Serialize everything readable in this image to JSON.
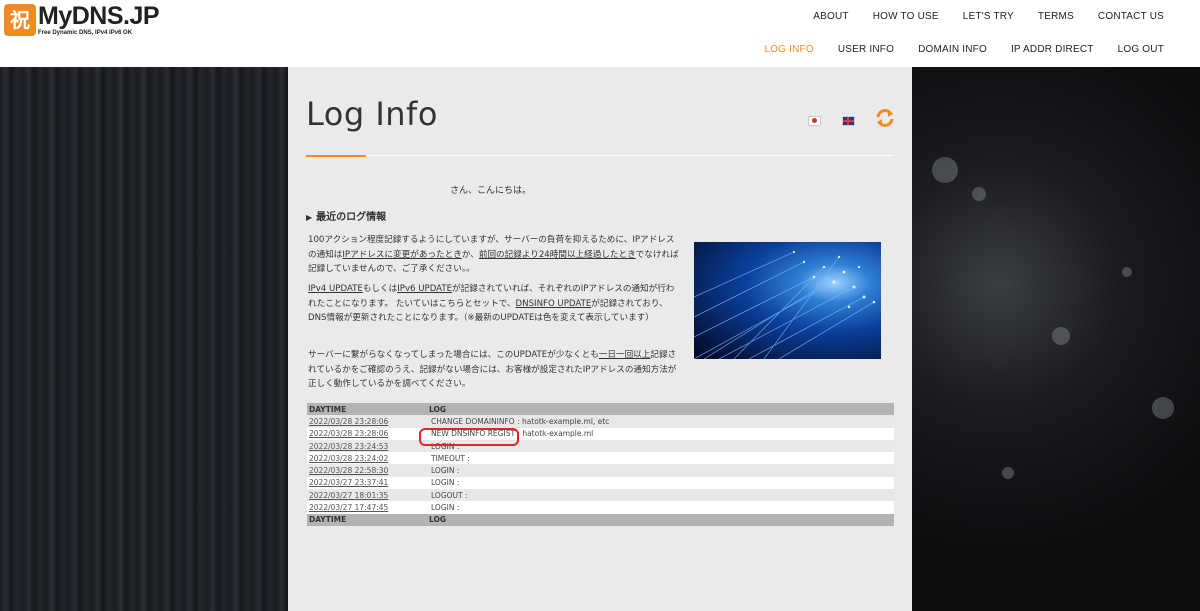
{
  "brand": {
    "logo_mark": "祝",
    "name": "MyDNS.JP",
    "tagline": "Free Dynamic DNS, IPv4 IPv6 OK"
  },
  "nav": {
    "primary": [
      "ABOUT",
      "HOW TO USE",
      "LET'S TRY",
      "TERMS",
      "CONTACT US"
    ],
    "secondary": [
      "LOG INFO",
      "USER INFO",
      "DOMAIN INFO",
      "IP ADDR DIRECT",
      "LOG OUT"
    ],
    "active": "LOG INFO"
  },
  "page": {
    "title": "Log Info",
    "greeting": "さん、こんにちは。",
    "section_title": "最近のログ情報",
    "para1_a": "100アクション程度記録するようにしていますが、サーバーの負荷を抑えるために、IPアドレスの通知は",
    "para1_link": "IPアドレスに変更があったとき",
    "para1_b": "か、",
    "para1_link2": "前回の記録より24時間以上経過したとき",
    "para1_c": "でなければ記録していませんので、ご了承ください。。",
    "para2_link1": "IPv4 UPDATE",
    "para2_a": "もしくは",
    "para2_link2": "IPv6 UPDATE",
    "para2_b": "が記録されていれば、それぞれのIPアドレスの通知が行われたことになります。 たいていはこちらとセットで、",
    "para2_link3": "DNSINFO UPDATE",
    "para2_c": "が記録されており、DNS情報が更新されたことになります。（※最新のUPDATEは色を変えて表示しています）",
    "para3_a": "サーバーに繋がらなくなってしまった場合には、このUPDATEが少なくとも",
    "para3_link": "一日一回以上",
    "para3_b": "記録されているかをご確認のうえ、記録がない場合には、お客様が設定されたIPアドレスの通知方法が正しく動作しているかを調べてください。"
  },
  "log_table": {
    "headers": [
      "DAYTIME",
      "LOG"
    ],
    "rows": [
      {
        "daytime": "2022/03/28 23:28:06",
        "log": "CHANGE DOMAININFO : hatotk-example.ml, etc"
      },
      {
        "daytime": "2022/03/28 23:28:06",
        "log": "NEW DNSINFO REGIST : hatotk-example.ml"
      },
      {
        "daytime": "2022/03/28 23:24:53",
        "log": "LOGIN :"
      },
      {
        "daytime": "2022/03/28 23:24:02",
        "log": "TIMEOUT :"
      },
      {
        "daytime": "2022/03/28 22:58:30",
        "log": "LOGIN :"
      },
      {
        "daytime": "2022/03/27 23:37:41",
        "log": "LOGIN :"
      },
      {
        "daytime": "2022/03/27 18:01:35",
        "log": "LOGOUT :"
      },
      {
        "daytime": "2022/03/27 17:47:45",
        "log": "LOGIN :"
      }
    ],
    "footer": [
      "DAYTIME",
      "LOG"
    ]
  },
  "colors": {
    "accent": "#f08a24",
    "highlight_ring": "#e5222a"
  }
}
